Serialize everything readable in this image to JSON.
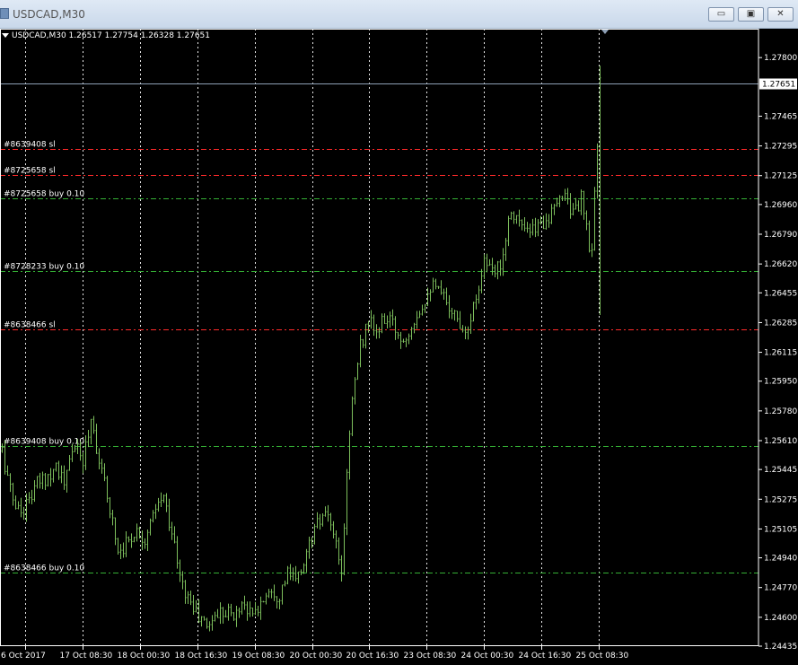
{
  "window": {
    "title": "USDCAD,M30",
    "minimize_label": "▭",
    "maximize_label": "▣",
    "close_label": "✕"
  },
  "symbol_info": "USDCAD,M30  1.26517 1.27754 1.26328 1.27651",
  "colors": {
    "background": "#000000",
    "candle": "#7dbf5c",
    "grid": "#ffffff",
    "stop_line": "#ff2a2a",
    "order_line": "#35b035",
    "bid_line": "#8ea0b6"
  },
  "chart_data": {
    "type": "bar",
    "y_ticks": [
      "1.27800",
      "1.27465",
      "1.27295",
      "1.27125",
      "1.26960",
      "1.26790",
      "1.26620",
      "1.26455",
      "1.26285",
      "1.26115",
      "1.25950",
      "1.25780",
      "1.25610",
      "1.25445",
      "1.25275",
      "1.25105",
      "1.24940",
      "1.24770",
      "1.24600",
      "1.24435"
    ],
    "ylim": [
      1.24435,
      1.27965
    ],
    "x_ticks": [
      "6 Oct 2017",
      "17 Oct 08:30",
      "18 Oct 00:30",
      "18 Oct 16:30",
      "19 Oct 08:30",
      "20 Oct 00:30",
      "20 Oct 16:30",
      "23 Oct 08:30",
      "24 Oct 00:30",
      "24 Oct 16:30",
      "25 Oct 08:30"
    ],
    "current_price": "1.27651",
    "order_lines": [
      {
        "label": "#8639408 sl",
        "price": 1.27275,
        "kind": "sl"
      },
      {
        "label": "#8725658 sl",
        "price": 1.2713,
        "kind": "sl"
      },
      {
        "label": "#8725658 buy 0.10",
        "price": 1.26995,
        "kind": "buy"
      },
      {
        "label": "#8728233 buy 0.10",
        "price": 1.2658,
        "kind": "buy"
      },
      {
        "label": "#8638466 sl",
        "price": 1.26245,
        "kind": "sl"
      },
      {
        "label": "#8639408 buy 0.10",
        "price": 1.2558,
        "kind": "buy"
      },
      {
        "label": "#8638466 buy 0.10",
        "price": 1.24855,
        "kind": "buy"
      }
    ],
    "close_path": [
      [
        0,
        1.2555
      ],
      [
        1,
        1.253
      ],
      [
        2,
        1.252
      ],
      [
        3,
        1.2527
      ],
      [
        4,
        1.2537
      ],
      [
        5,
        1.254
      ],
      [
        6,
        1.2548
      ],
      [
        7,
        1.2535
      ],
      [
        8,
        1.256
      ],
      [
        9,
        1.2548
      ],
      [
        10,
        1.2575
      ],
      [
        11,
        1.2545
      ],
      [
        12,
        1.2525
      ],
      [
        13,
        1.2498
      ],
      [
        14,
        1.2503
      ],
      [
        15,
        1.251
      ],
      [
        16,
        1.2505
      ],
      [
        17,
        1.2518
      ],
      [
        18,
        1.253
      ],
      [
        19,
        1.251
      ],
      [
        20,
        1.248
      ],
      [
        21,
        1.247
      ],
      [
        22,
        1.246
      ],
      [
        23,
        1.2455
      ],
      [
        24,
        1.2462
      ],
      [
        25,
        1.2465
      ],
      [
        26,
        1.246
      ],
      [
        27,
        1.247
      ],
      [
        28,
        1.246
      ],
      [
        29,
        1.2468
      ],
      [
        30,
        1.2478
      ],
      [
        31,
        1.2472
      ],
      [
        32,
        1.2485
      ],
      [
        33,
        1.248
      ],
      [
        34,
        1.2495
      ],
      [
        35,
        1.251
      ],
      [
        36,
        1.2518
      ],
      [
        37,
        1.2512
      ],
      [
        38,
        1.2482
      ],
      [
        39,
        1.2575
      ],
      [
        40,
        1.2612
      ],
      [
        41,
        1.263
      ],
      [
        42,
        1.2622
      ],
      [
        43,
        1.2632
      ],
      [
        44,
        1.2625
      ],
      [
        45,
        1.2618
      ],
      [
        46,
        1.263
      ],
      [
        47,
        1.2638
      ],
      [
        48,
        1.265
      ],
      [
        49,
        1.2645
      ],
      [
        50,
        1.264
      ],
      [
        51,
        1.263
      ],
      [
        52,
        1.2625
      ],
      [
        53,
        1.264
      ],
      [
        54,
        1.2665
      ],
      [
        55,
        1.2655
      ],
      [
        56,
        1.2665
      ],
      [
        57,
        1.2695
      ],
      [
        58,
        1.2685
      ],
      [
        59,
        1.2678
      ],
      [
        60,
        1.2684
      ],
      [
        61,
        1.2688
      ],
      [
        62,
        1.2692
      ],
      [
        63,
        1.2705
      ],
      [
        64,
        1.269
      ],
      [
        65,
        1.27
      ],
      [
        66,
        1.266
      ],
      [
        67,
        1.2765
      ]
    ]
  }
}
